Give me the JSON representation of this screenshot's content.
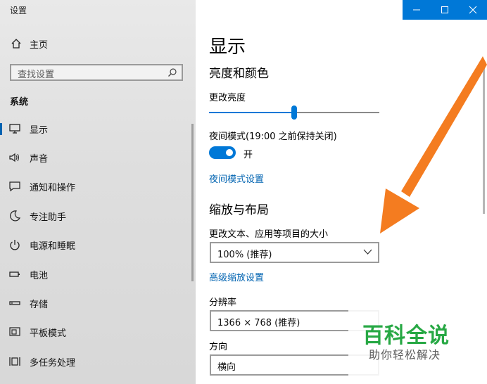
{
  "window": {
    "title": "设置"
  },
  "sidebar": {
    "home_label": "主页",
    "search_placeholder": "查找设置",
    "section_title": "系统",
    "items": [
      {
        "label": "显示",
        "icon": "monitor-icon",
        "active": true
      },
      {
        "label": "声音",
        "icon": "speaker-icon"
      },
      {
        "label": "通知和操作",
        "icon": "notification-icon"
      },
      {
        "label": "专注助手",
        "icon": "moon-icon"
      },
      {
        "label": "电源和睡眠",
        "icon": "power-icon"
      },
      {
        "label": "电池",
        "icon": "battery-icon"
      },
      {
        "label": "存储",
        "icon": "storage-icon"
      },
      {
        "label": "平板模式",
        "icon": "tablet-icon"
      },
      {
        "label": "多任务处理",
        "icon": "multitask-icon"
      }
    ]
  },
  "main": {
    "title": "显示",
    "brightness_section": "亮度和颜色",
    "brightness_label": "更改亮度",
    "brightness_level": 0.5,
    "night_light_label": "夜间模式(19:00 之前保持关闭)",
    "night_toggle_state": "开",
    "night_settings_link": "夜间模式设置",
    "scale_section": "缩放与布局",
    "scale_label": "更改文本、应用等项目的大小",
    "scale_value": "100% (推荐)",
    "advanced_scale_link": "高级缩放设置",
    "resolution_label": "分辨率",
    "resolution_value": "1366 × 768 (推荐)",
    "orientation_label": "方向",
    "orientation_value": "横向"
  },
  "watermark": {
    "big": "百科全说",
    "small": "助你轻松解决"
  },
  "colors": {
    "accent": "#0078d7",
    "link": "#0063b1",
    "arrow": "#f47c20",
    "watermark": "#27a844"
  }
}
